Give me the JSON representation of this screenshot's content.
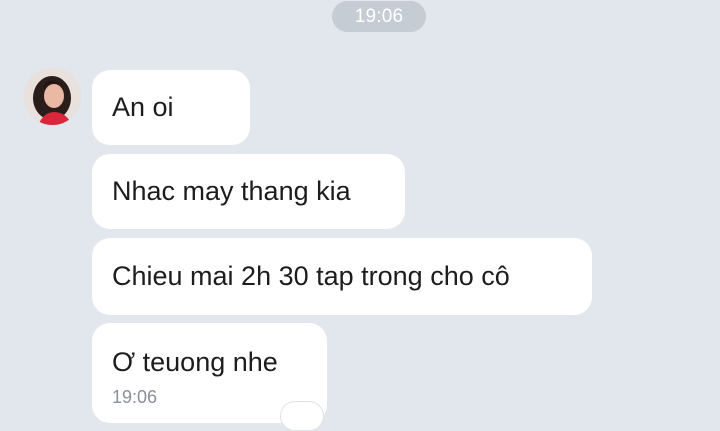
{
  "header": {
    "time_divider": "19:06"
  },
  "chat": {
    "sender_avatar": "avatar",
    "messages": [
      {
        "text": "An oi"
      },
      {
        "text": "Nhac may thang kia"
      },
      {
        "text": "Chieu mai 2h 30 tap trong cho cô"
      },
      {
        "text": "Ơ teuong nhe",
        "timestamp": "19:06"
      }
    ]
  }
}
